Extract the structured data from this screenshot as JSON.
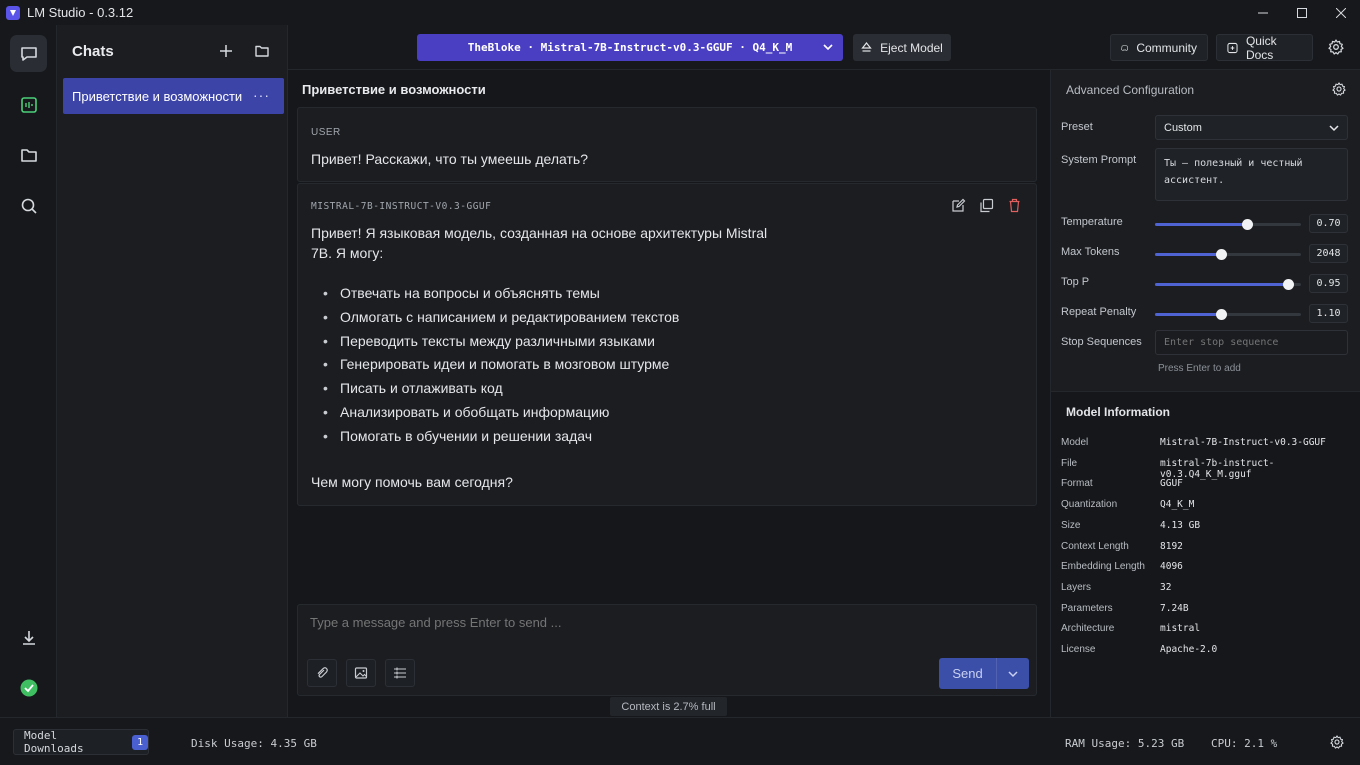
{
  "app": {
    "title": "LM Studio - 0.3.12"
  },
  "sidebar": {
    "title": "Chats",
    "chats": [
      {
        "label": "Приветствие и возможности",
        "more": "···"
      }
    ]
  },
  "topbar": {
    "model_label": "TheBloke · Mistral-7B-Instruct-v0.3-GGUF · Q4_K_M",
    "eject_label": "Eject Model",
    "community_label": "Community",
    "docs_label": "Quick Docs"
  },
  "chat": {
    "title": "Приветствие и возможности",
    "messages": [
      {
        "role": "USER",
        "text": "Привет! Расскажи, что ты умеешь делать?"
      },
      {
        "role": "MISTRAL-7B-INSTRUCT-V0.3-GGUF",
        "intro_line1": "Привет! Я языковая модель, созданная на основе архитектуры Mistral",
        "intro_line2": "7B. Я могу:",
        "bullets": [
          "Отвечать на вопросы и объяснять темы",
          "Олмогать с написанием и редактированием текстов",
          "Переводить тексты между различными языками",
          "Генерировать идеи и помогать в мозговом штурме",
          "Писать и отлаживать код",
          "Анализировать и обобщать информацию",
          "Помогать в обучении и решении задач"
        ],
        "outro": "Чем могу помочь вам сегодня?"
      }
    ],
    "composer_placeholder": "Type a message and press Enter to send ...",
    "send_label": "Send",
    "context_text": "Context is 2.7% full"
  },
  "config": {
    "title": "Advanced Configuration",
    "preset_label": "Preset",
    "preset_value": "Custom",
    "system_prompt_label": "System Prompt",
    "system_prompt_line1": "Ты — полезный и честный",
    "system_prompt_line2": "ассистент.",
    "sliders": [
      {
        "label": "Temperature",
        "value": "0.70",
        "fraction": 0.63
      },
      {
        "label": "Max Tokens",
        "value": "2048",
        "fraction": 0.45
      },
      {
        "label": "Top P",
        "value": "0.95",
        "fraction": 0.91
      },
      {
        "label": "Repeat Penalty",
        "value": "1.10",
        "fraction": 0.45
      }
    ],
    "stop_label": "Stop Sequences",
    "stop_placeholder": "Enter stop sequence",
    "stop_hint": "Press Enter to add"
  },
  "model_info": {
    "title": "Model Information",
    "rows": [
      {
        "key": "Model",
        "value": "Mistral-7B-Instruct-v0.3-GGUF"
      },
      {
        "key": "File",
        "value": "mistral-7b-instruct-v0.3.Q4_K_M.gguf"
      },
      {
        "key": "Format",
        "value": "GGUF"
      },
      {
        "key": "Quantization",
        "value": "Q4_K_M"
      },
      {
        "key": "Size",
        "value": "4.13 GB"
      },
      {
        "key": "Context Length",
        "value": "8192"
      },
      {
        "key": "Embedding Length",
        "value": "4096"
      },
      {
        "key": "Layers",
        "value": "32"
      },
      {
        "key": "Parameters",
        "value": "7.24B"
      },
      {
        "key": "Architecture",
        "value": "mistral"
      },
      {
        "key": "License",
        "value": "Apache-2.0"
      }
    ]
  },
  "statusbar": {
    "downloads_label": "Model Downloads",
    "downloads_count": "1",
    "disk_usage": "Disk Usage: 4.35 GB",
    "ram_usage": "RAM Usage: 5.23 GB",
    "cpu": "CPU: 2.1 %"
  },
  "colors": {
    "accent": "#4a3fc2",
    "selected_chat": "#3d44a8",
    "status_ok": "#3fbf62"
  }
}
